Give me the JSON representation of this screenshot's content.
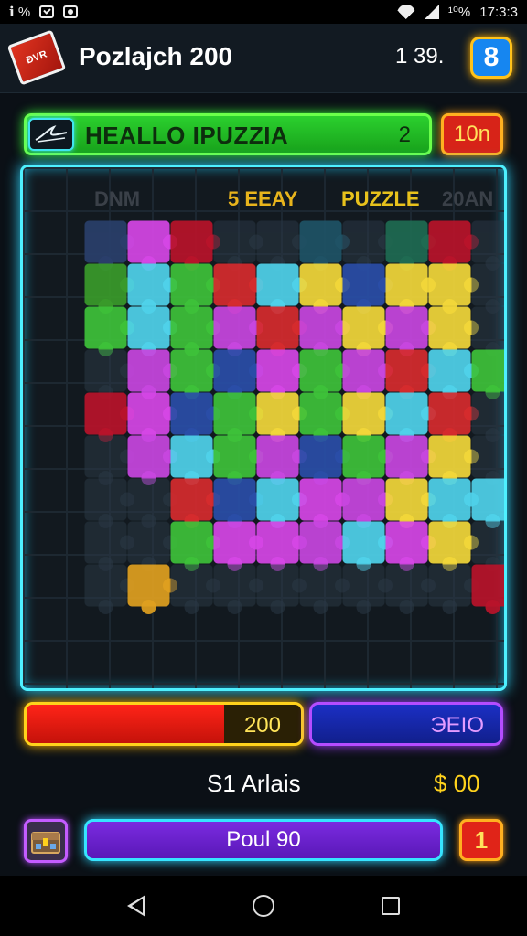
{
  "status_bar": {
    "left_text": "ℹ %",
    "battery": "¹⁰%",
    "time": "17:3:3"
  },
  "header": {
    "logo_text": "ĐVR",
    "title": "Pozlajch 200",
    "score": "1 39.",
    "menu_label": "8"
  },
  "level_bar": {
    "name": "HEALLO IPUZZIA",
    "number": "2",
    "timer": "10n"
  },
  "board": {
    "labels": [
      "DNM",
      "5  EEAY",
      "PUZZLE",
      "20AN"
    ],
    "columns": 11,
    "rows": 11,
    "pieces": [
      [
        null,
        "#2a3f6b",
        "#d646e6",
        "#b9132a",
        "#2a3845",
        "#2a3845",
        "#1f5366",
        "#2a3845",
        "#1f6b52",
        "#b9132a",
        "#2a3845"
      ],
      [
        null,
        "#3a9b2a",
        "#4fd2ea",
        "#3ec23a",
        "#d62b2e",
        "#4fd2ea",
        "#f2d73a",
        "#2a4ea8",
        "#f2d73a",
        "#f2d73a",
        "#2a3845"
      ],
      [
        null,
        "#3ec23a",
        "#4fd2ea",
        "#3ec23a",
        "#c846e0",
        "#d62b2e",
        "#c846e0",
        "#f2d73a",
        "#c846e0",
        "#f2d73a",
        "#2a3845"
      ],
      [
        null,
        "#2a3845",
        "#c846e0",
        "#3ec23a",
        "#2a4ea8",
        "#d646e6",
        "#3ec23a",
        "#c846e0",
        "#d62b2e",
        "#4fd2ea",
        "#3ec23a"
      ],
      [
        null,
        "#b9132a",
        "#d646e6",
        "#2a4ea8",
        "#3ec23a",
        "#f2d73a",
        "#3ec23a",
        "#f2d73a",
        "#4fd2ea",
        "#d62b2e",
        "#2a3845"
      ],
      [
        null,
        "#2a3845",
        "#c846e0",
        "#4fd2ea",
        "#3ec23a",
        "#c846e0",
        "#2a4ea8",
        "#3ec23a",
        "#c846e0",
        "#f2d73a",
        "#2a3845"
      ],
      [
        null,
        "#2a3845",
        "#2a3845",
        "#d62b2e",
        "#2a4ea8",
        "#4fd2ea",
        "#d646e6",
        "#c846e0",
        "#f2d73a",
        "#4fd2ea",
        "#4fd2ea"
      ],
      [
        null,
        "#2a3845",
        "#2a3845",
        "#3ec23a",
        "#d646e6",
        "#d646e6",
        "#c846e0",
        "#4fd2ea",
        "#d646e6",
        "#f2d73a",
        "#2a3845"
      ],
      [
        null,
        "#2a3845",
        "#e0a020",
        "#2a3845",
        "#2a3845",
        "#2a3845",
        "#2a3845",
        "#2a3845",
        "#2a3845",
        "#2a3845",
        "#b9132a"
      ]
    ]
  },
  "progress": {
    "value_label": "200",
    "fill_fraction": 0.72,
    "bonus_label": "ЭЕIO"
  },
  "status": {
    "text": "S1 Arlais",
    "coins": "$ 00"
  },
  "bottom": {
    "play_label": "Poul 90",
    "count": "1"
  },
  "colors": {
    "accent_cyan": "#4ef0ff",
    "accent_green": "#35ff35",
    "accent_yellow": "#ffd21c",
    "accent_purple": "#b44cff"
  }
}
